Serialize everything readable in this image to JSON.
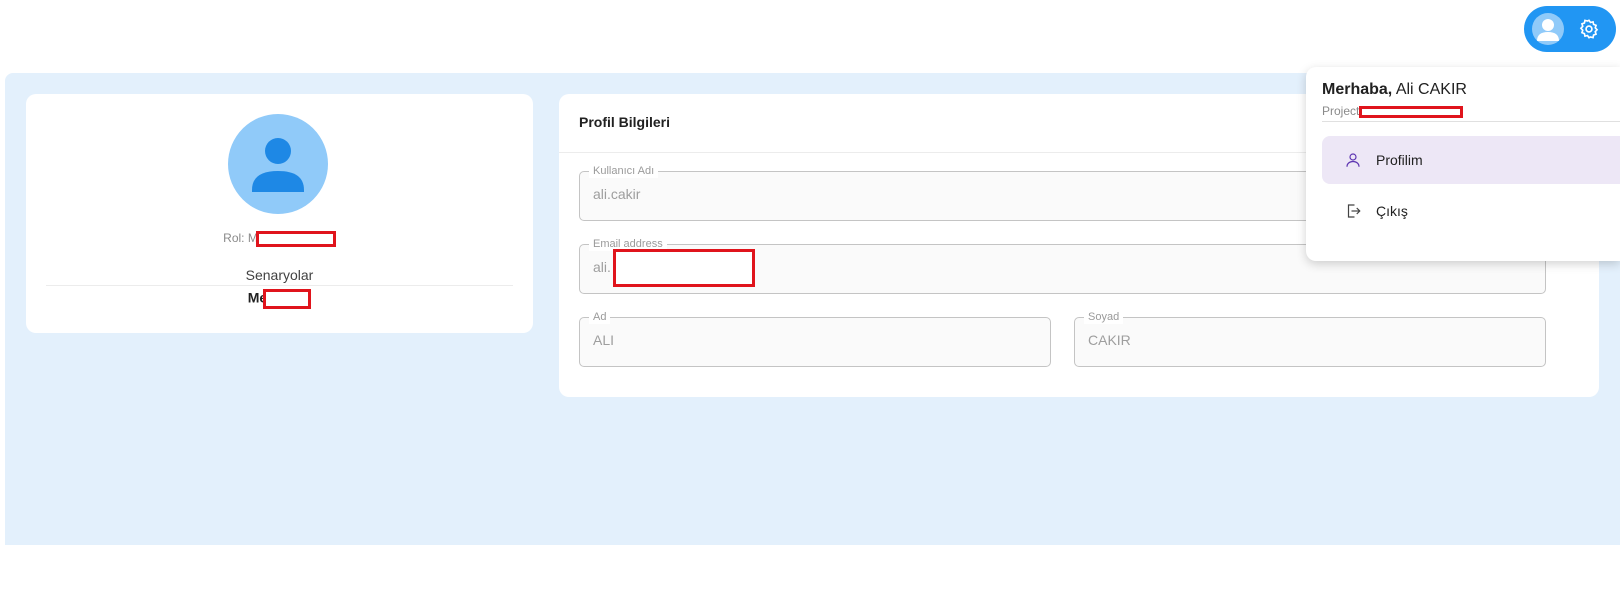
{
  "header": {
    "avatar_icon": "person-icon",
    "settings_icon": "gear-icon",
    "accent_color": "#2196f3"
  },
  "profile_card": {
    "avatar_icon": "person-icon",
    "role_label": "Rol: M",
    "scenarios_title": "Senaryolar",
    "scenario_item": "Me"
  },
  "profile_form": {
    "title": "Profil Bilgileri",
    "username": {
      "label": "Kullanıcı Adı",
      "value": "ali.cakir"
    },
    "email": {
      "label": "Email address",
      "value": "ali."
    },
    "first_name": {
      "label": "Ad",
      "value": "ALI"
    },
    "last_name": {
      "label": "Soyad",
      "value": "CAKIR"
    }
  },
  "user_menu": {
    "greeting_prefix": "Merhaba,",
    "user_name": "Ali CAKIR",
    "project_label": "Project",
    "items": [
      {
        "label": "Profilim",
        "icon": "person-outline-icon"
      },
      {
        "label": "Çıkış",
        "icon": "logout-icon"
      }
    ]
  }
}
